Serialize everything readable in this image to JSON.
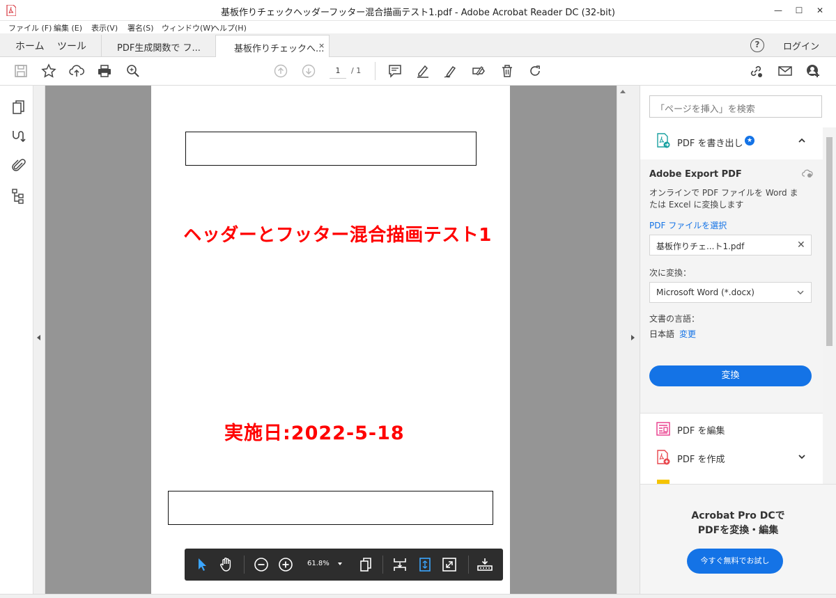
{
  "window": {
    "title": "基板作りチェックヘッダーフッター混合描画テスト1.pdf - Adobe Acrobat Reader DC (32-bit)",
    "minimize": "—",
    "maximize": "☐",
    "close": "✕"
  },
  "menu": [
    "ファイル (F)",
    "編集 (E)",
    "表示(V)",
    "署名(S)",
    "ウィンドウ(W)",
    "ヘルプ(H)"
  ],
  "tabs": {
    "home": "ホーム",
    "tools": "ツール",
    "doc1": "PDF生成関数で フ...",
    "doc2": "基板作りチェックへ...",
    "close_glyph": "×",
    "help_glyph": "?",
    "login": "ログイン"
  },
  "toolbar": {
    "page_current": "1",
    "page_total": "/ 1"
  },
  "document": {
    "title": "ヘッダーとフッター混合描画テスト1",
    "date": "実施日:2022-5-18"
  },
  "floating_toolbar": {
    "zoom": "61.8%"
  },
  "right_panel": {
    "search_placeholder": "「ページを挿入」を検索",
    "export_section": "PDF を書き出し",
    "badge": "★",
    "export_title": "Adobe Export PDF",
    "export_desc": "オンラインで PDF ファイルを Word または Excel に変換します",
    "select_file_link": "PDF ファイルを選択",
    "file_name": "基板作りチェ...ト1.pdf",
    "file_clear": "✕",
    "convert_to_label": "次に変換：",
    "convert_to_value": "Microsoft Word (*.docx)",
    "lang_label": "文書の言語：",
    "lang_value": "日本語",
    "lang_change": "変更",
    "convert_button": "変換",
    "tools": [
      {
        "label": "PDF を編集"
      },
      {
        "label": "PDF を作成"
      }
    ],
    "promo_line1": "Acrobat Pro DCで",
    "promo_line2": "PDFを変換・編集",
    "promo_button": "今すぐ無料でお試し"
  },
  "colors": {
    "accent": "#1473e6",
    "doc_red": "#ff0000",
    "edit_pink": "#e8398a",
    "create_red": "#e8454b",
    "export_teal": "#1aa1a1"
  }
}
